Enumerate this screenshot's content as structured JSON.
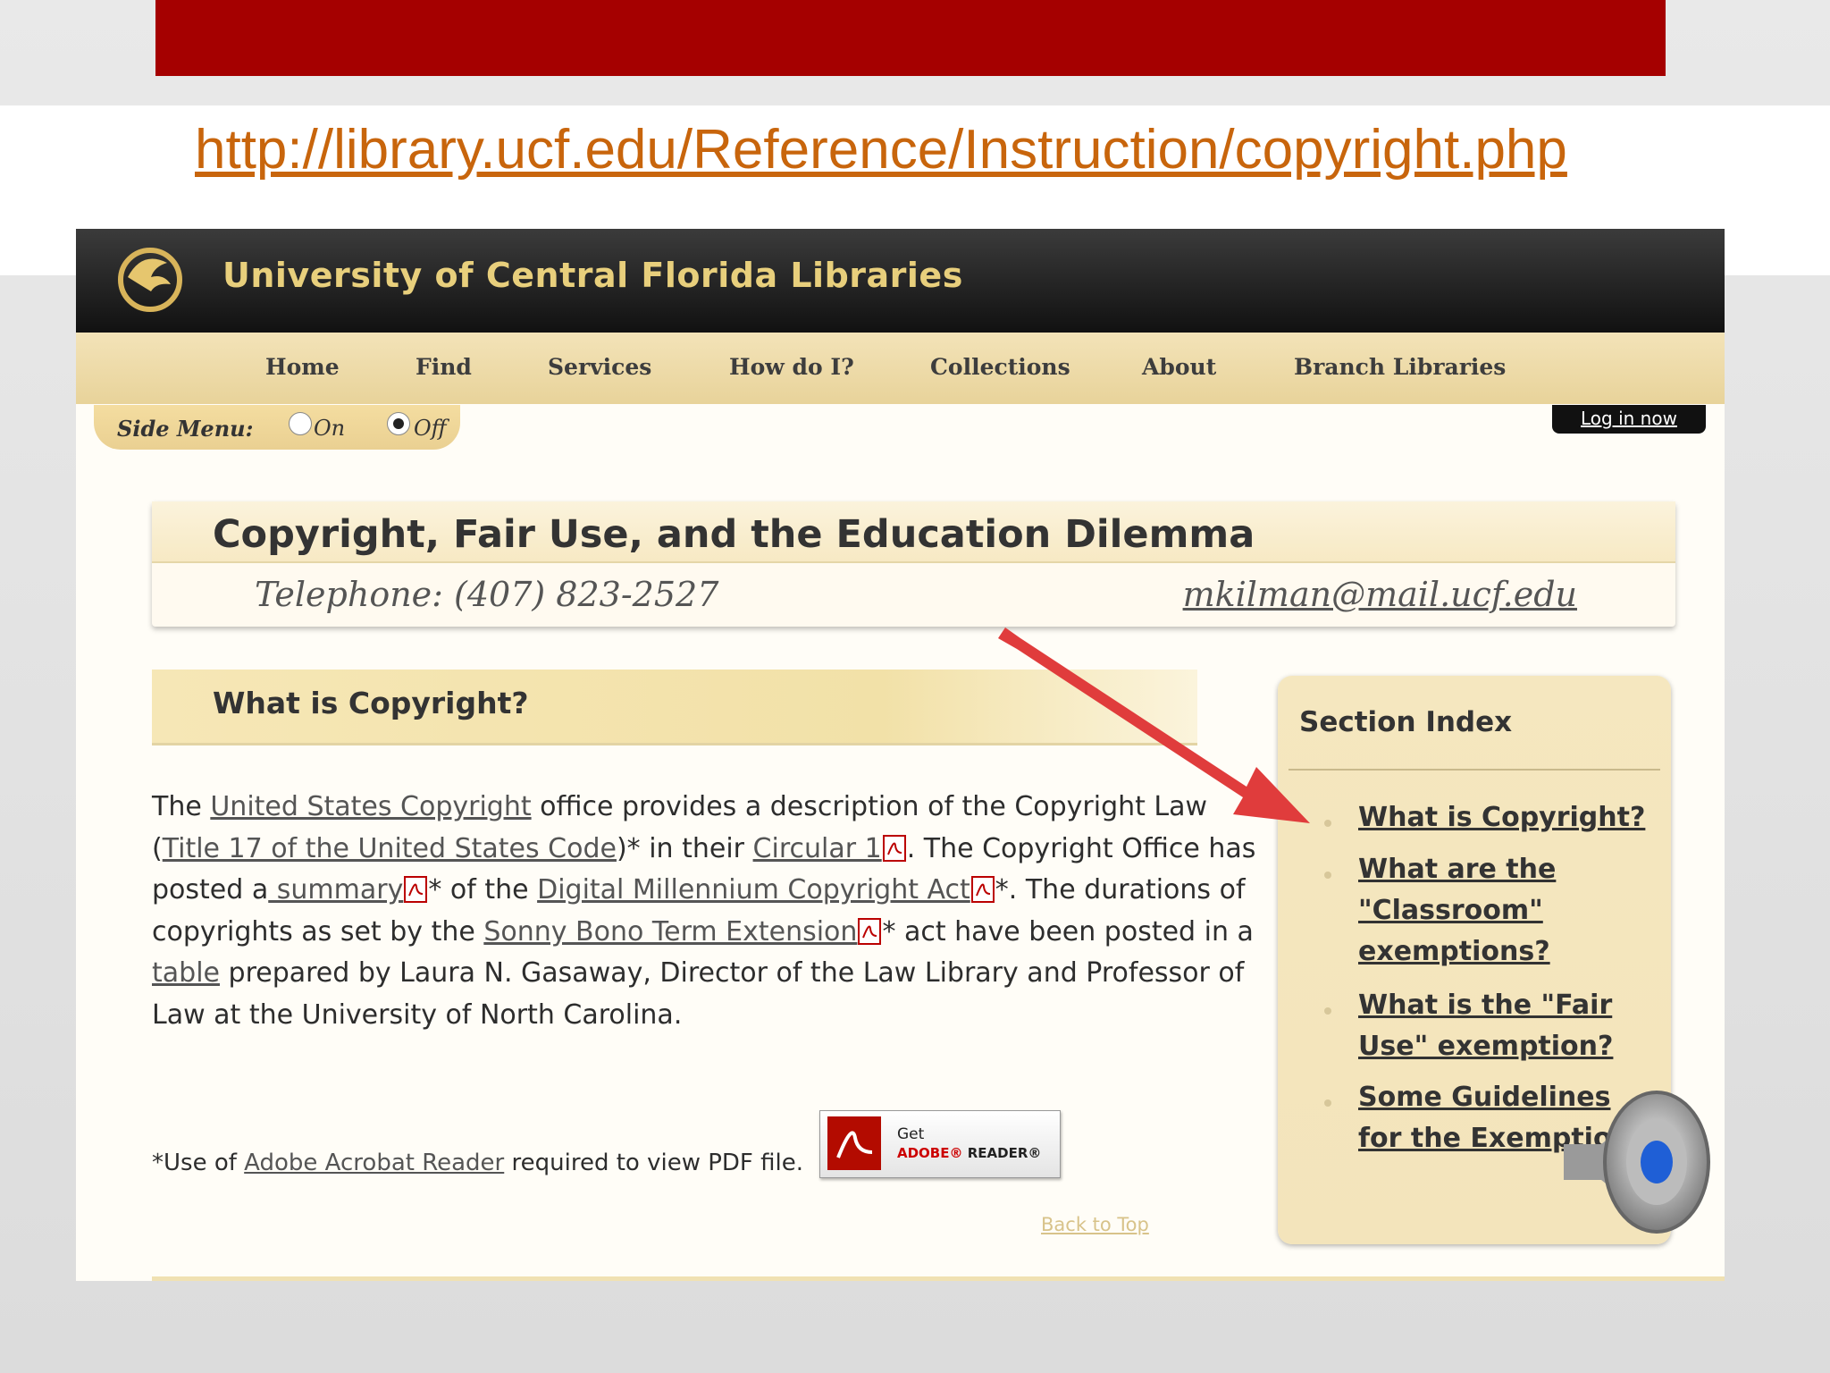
{
  "url": "http://library.ucf.edu/Reference/Instruction/copyright.php",
  "site": {
    "title": "University of Central Florida Libraries",
    "nav": [
      "Home",
      "Find",
      "Services",
      "How do I?",
      "Collections",
      "About",
      "Branch Libraries"
    ],
    "side_menu": {
      "label": "Side Menu:",
      "on": "On",
      "off": "Off",
      "selected": "Off"
    },
    "login": "Log in now"
  },
  "page": {
    "title": "Copyright, Fair Use, and the Education Dilemma",
    "phone": "Telephone: (407) 823-2527",
    "email": "mkilman@mail.ucf.edu"
  },
  "section": {
    "title": "What is Copyright?",
    "body": {
      "t1": "The ",
      "l1": "United States Copyright",
      "t2": " office provides a description of the Copyright Law (",
      "l2": "Title 17 of the United States Code",
      "t3": ")* in their ",
      "l3": "Circular 1",
      "t4": ". The Copyright Office has posted a",
      "l4": " summary",
      "t5": "* of the ",
      "l5": "Digital Millennium Copyright Act",
      "t6": "*. The durations of copyrights as set by the ",
      "l6": "Sonny Bono Term Extension",
      "t7": "* act have been posted in a ",
      "l7": "table",
      "t8": " prepared by Laura N. Gasaway, Director of the Law Library and Professor of Law at the University of North Carolina."
    },
    "footnote_pre": "*Use of ",
    "footnote_link": "Adobe Acrobat Reader",
    "footnote_post": " required to view PDF file.",
    "adobe": {
      "get": "Get",
      "brand": "ADOBE",
      "reader": "READER"
    },
    "back_to_top": "Back to Top"
  },
  "index": {
    "title": "Section Index",
    "items": [
      "What is Copyright?",
      "What are the \"Classroom\" exemptions?",
      "What is the \"Fair Use\" exemption?",
      "Some Guidelines for the Exemptions"
    ]
  },
  "colors": {
    "banner": "#a50000",
    "url": "#c8650c",
    "arrow": "#e03c3c",
    "nav_bg": "#e8d39a"
  }
}
